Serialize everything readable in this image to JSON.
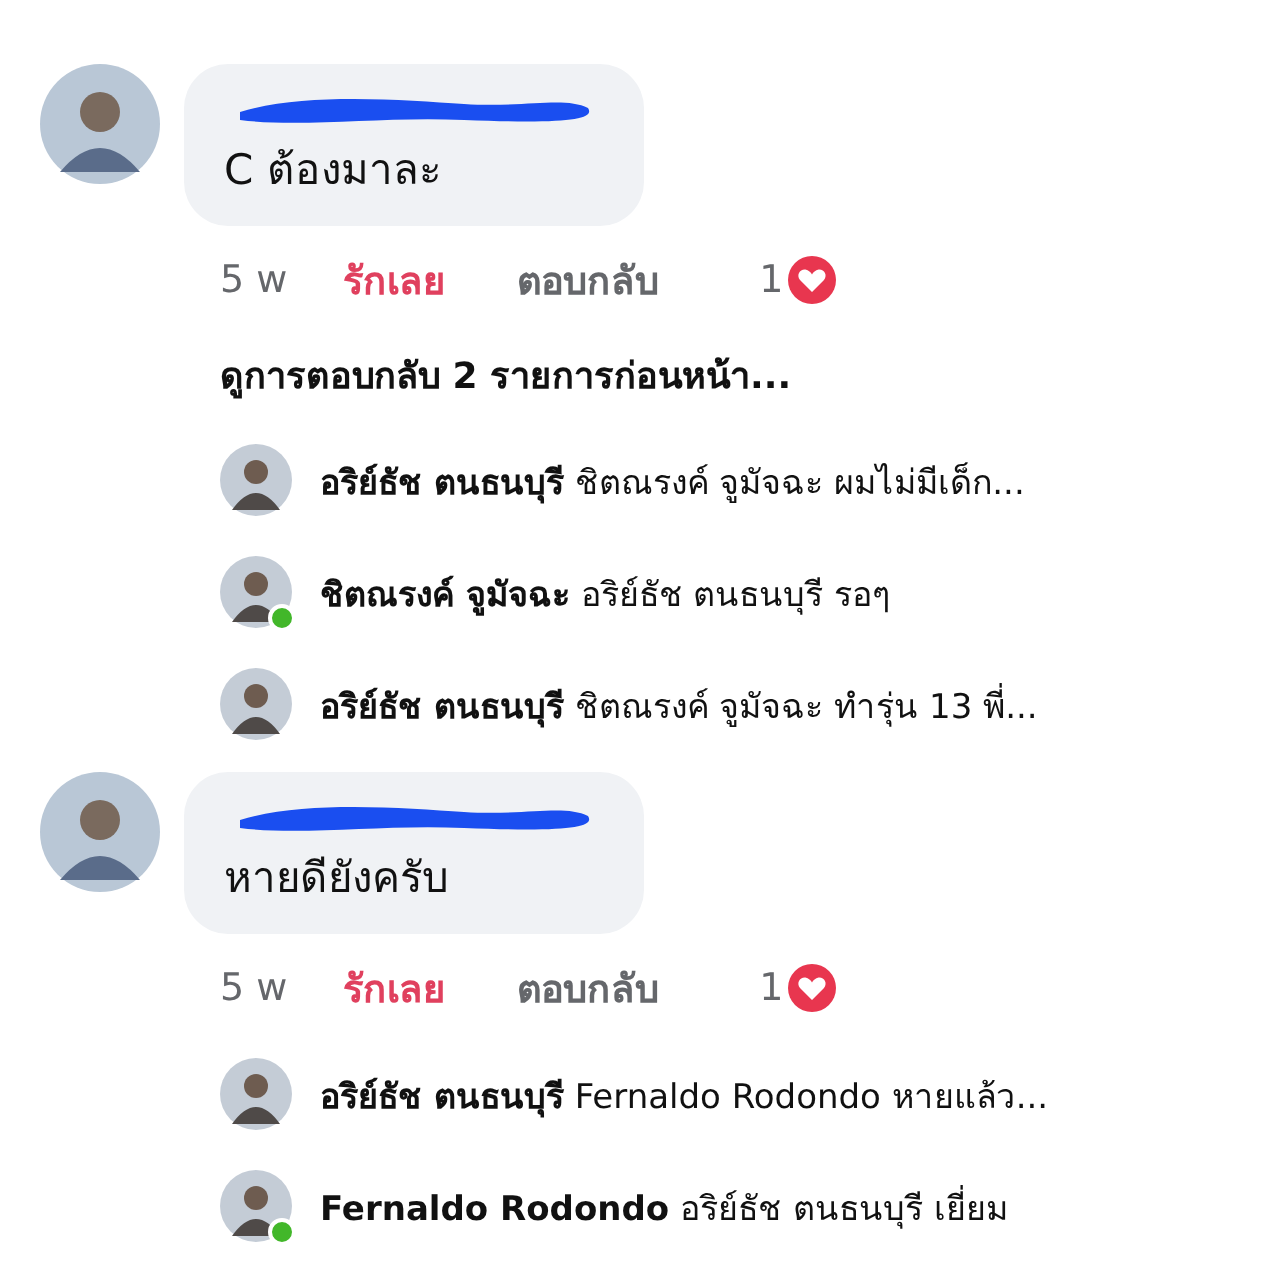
{
  "comments": [
    {
      "name_redacted": true,
      "text": "C ต้องมาละ",
      "time": "5 w",
      "reacted": true,
      "react_label": "รักเลย",
      "reply_label": "ตอบกลับ",
      "reaction_count": "1",
      "previous_replies": "ดูการตอบกลับ 2 รายการก่อนหน้า...",
      "replies": [
        {
          "name": "อริย์ธัช ตนธนบุรี",
          "text": "ชิตณรงค์ จูมัจฉะ ผมไม่มีเด็ก...",
          "online": false
        },
        {
          "name": "ชิตณรงค์ จูมัจฉะ",
          "text": "อริย์ธัช ตนธนบุรี  รอๆ",
          "online": true
        },
        {
          "name": "อริย์ธัช ตนธนบุรี",
          "text": "ชิตณรงค์ จูมัจฉะ ทำรุ่น 13 พี่...",
          "online": false
        }
      ]
    },
    {
      "name_redacted": true,
      "text": "หายดียังครับ",
      "time": "5 w",
      "reacted": true,
      "react_label": "รักเลย",
      "reply_label": "ตอบกลับ",
      "reaction_count": "1",
      "replies": [
        {
          "name": "อริย์ธัช ตนธนบุรี",
          "text": "Fernaldo Rodondo หายแล้ว...",
          "online": false
        },
        {
          "name": "Fernaldo Rodondo",
          "text": "อริย์ธัช ตนธนบุรี เยี่ยม",
          "online": true
        }
      ]
    }
  ]
}
